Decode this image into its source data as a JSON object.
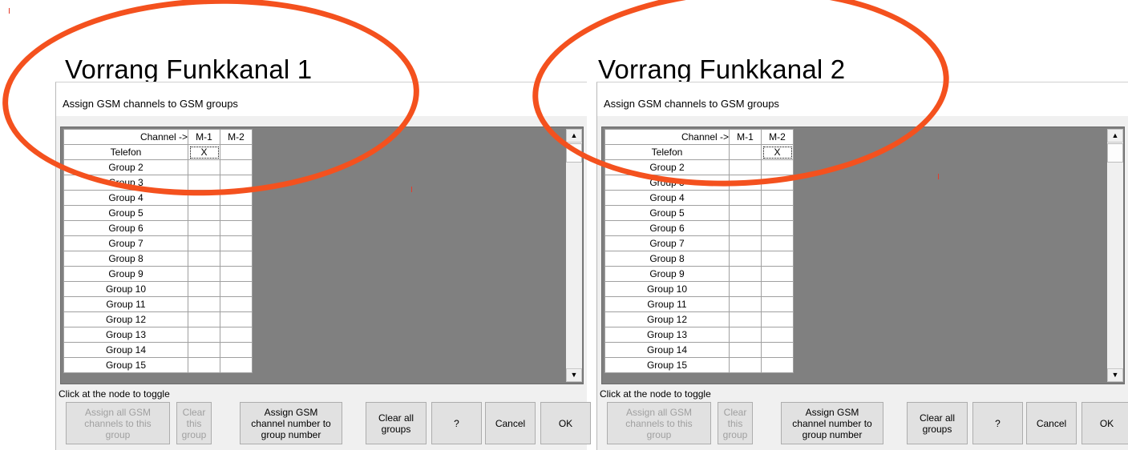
{
  "panels": [
    {
      "heading": "Vorrang Funkkanal 1",
      "dialog_title": "Assign GSM channels to GSM groups",
      "header_label": "Channel ->",
      "columns": [
        "M-1",
        "M-2"
      ],
      "rows": [
        {
          "label": "Telefon",
          "cells": [
            "X",
            ""
          ]
        },
        {
          "label": "Group 2",
          "cells": [
            "",
            ""
          ]
        },
        {
          "label": "Group 3",
          "cells": [
            "",
            ""
          ]
        },
        {
          "label": "Group 4",
          "cells": [
            "",
            ""
          ]
        },
        {
          "label": "Group 5",
          "cells": [
            "",
            ""
          ]
        },
        {
          "label": "Group 6",
          "cells": [
            "",
            ""
          ]
        },
        {
          "label": "Group 7",
          "cells": [
            "",
            ""
          ]
        },
        {
          "label": "Group 8",
          "cells": [
            "",
            ""
          ]
        },
        {
          "label": "Group 9",
          "cells": [
            "",
            ""
          ]
        },
        {
          "label": "Group 10",
          "cells": [
            "",
            ""
          ]
        },
        {
          "label": "Group 11",
          "cells": [
            "",
            ""
          ]
        },
        {
          "label": "Group 12",
          "cells": [
            "",
            ""
          ]
        },
        {
          "label": "Group 13",
          "cells": [
            "",
            ""
          ]
        },
        {
          "label": "Group 14",
          "cells": [
            "",
            ""
          ]
        },
        {
          "label": "Group 15",
          "cells": [
            "",
            ""
          ]
        }
      ],
      "hint": "Click at the node to toggle",
      "buttons": {
        "assign_all": "Assign all GSM\nchannels to this\ngroup",
        "clear_group": "Clear this\ngroup",
        "assign_number": "Assign GSM\nchannel number to\ngroup number",
        "clear_all": "Clear all\ngroups",
        "help": "?",
        "cancel": "Cancel",
        "ok": "OK"
      }
    },
    {
      "heading": "Vorrang Funkkanal 2",
      "dialog_title": "Assign GSM channels to GSM groups",
      "header_label": "Channel ->",
      "columns": [
        "M-1",
        "M-2"
      ],
      "rows": [
        {
          "label": "Telefon",
          "cells": [
            "",
            "X"
          ]
        },
        {
          "label": "Group 2",
          "cells": [
            "",
            ""
          ]
        },
        {
          "label": "Group 3",
          "cells": [
            "",
            ""
          ]
        },
        {
          "label": "Group 4",
          "cells": [
            "",
            ""
          ]
        },
        {
          "label": "Group 5",
          "cells": [
            "",
            ""
          ]
        },
        {
          "label": "Group 6",
          "cells": [
            "",
            ""
          ]
        },
        {
          "label": "Group 7",
          "cells": [
            "",
            ""
          ]
        },
        {
          "label": "Group 8",
          "cells": [
            "",
            ""
          ]
        },
        {
          "label": "Group 9",
          "cells": [
            "",
            ""
          ]
        },
        {
          "label": "Group 10",
          "cells": [
            "",
            ""
          ]
        },
        {
          "label": "Group 11",
          "cells": [
            "",
            ""
          ]
        },
        {
          "label": "Group 12",
          "cells": [
            "",
            ""
          ]
        },
        {
          "label": "Group 13",
          "cells": [
            "",
            ""
          ]
        },
        {
          "label": "Group 14",
          "cells": [
            "",
            ""
          ]
        },
        {
          "label": "Group 15",
          "cells": [
            "",
            ""
          ]
        }
      ],
      "hint": "Click at the node to toggle",
      "buttons": {
        "assign_all": "Assign all GSM\nchannels to this\ngroup",
        "clear_group": "Clear this\ngroup",
        "assign_number": "Assign GSM\nchannel number to\ngroup number",
        "clear_all": "Clear all\ngroups",
        "help": "?",
        "cancel": "Cancel",
        "ok": "OK"
      }
    }
  ],
  "scrollbar_icons": {
    "up": "scroll-up-arrow-icon",
    "down": "scroll-down-arrow-icon"
  },
  "colors": {
    "annotation": "#f4511e",
    "grid_background": "#808080",
    "dialog_background": "#f0f0f0"
  }
}
